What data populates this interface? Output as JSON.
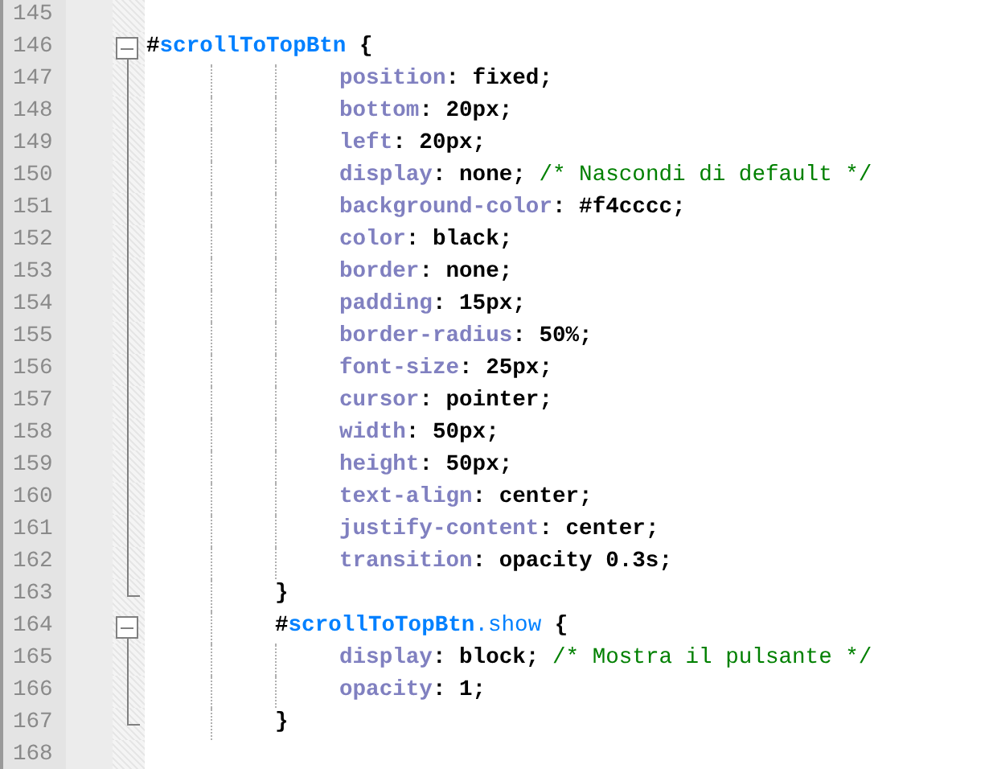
{
  "editor": {
    "lines": [
      {
        "number": "145",
        "kind": "blank"
      },
      {
        "number": "146",
        "kind": "rule",
        "tokens": [
          {
            "kind": "punct",
            "text": "#"
          },
          {
            "kind": "selector",
            "text": "scrollToTopBtn"
          },
          {
            "kind": "punct",
            "text": " {"
          }
        ]
      },
      {
        "number": "147",
        "kind": "declaration",
        "tokens": [
          {
            "kind": "property",
            "text": "position"
          },
          {
            "kind": "value",
            "text": ": fixed;"
          }
        ]
      },
      {
        "number": "148",
        "kind": "declaration",
        "tokens": [
          {
            "kind": "property",
            "text": "bottom"
          },
          {
            "kind": "value",
            "text": ": 20px;"
          }
        ]
      },
      {
        "number": "149",
        "kind": "declaration",
        "tokens": [
          {
            "kind": "property",
            "text": "left"
          },
          {
            "kind": "value",
            "text": ": 20px;"
          }
        ]
      },
      {
        "number": "150",
        "kind": "declaration",
        "tokens": [
          {
            "kind": "property",
            "text": "display"
          },
          {
            "kind": "value",
            "text": ": none; "
          },
          {
            "kind": "comment",
            "text": "/* Nascondi di default */"
          }
        ]
      },
      {
        "number": "151",
        "kind": "declaration",
        "tokens": [
          {
            "kind": "property",
            "text": "background-color"
          },
          {
            "kind": "value",
            "text": ": #f4cccc;"
          }
        ]
      },
      {
        "number": "152",
        "kind": "declaration",
        "tokens": [
          {
            "kind": "property",
            "text": "color"
          },
          {
            "kind": "value",
            "text": ": black;"
          }
        ]
      },
      {
        "number": "153",
        "kind": "declaration",
        "tokens": [
          {
            "kind": "property",
            "text": "border"
          },
          {
            "kind": "value",
            "text": ": none;"
          }
        ]
      },
      {
        "number": "154",
        "kind": "declaration",
        "tokens": [
          {
            "kind": "property",
            "text": "padding"
          },
          {
            "kind": "value",
            "text": ": 15px;"
          }
        ]
      },
      {
        "number": "155",
        "kind": "declaration",
        "tokens": [
          {
            "kind": "property",
            "text": "border-radius"
          },
          {
            "kind": "value",
            "text": ": 50%;"
          }
        ]
      },
      {
        "number": "156",
        "kind": "declaration",
        "tokens": [
          {
            "kind": "property",
            "text": "font-size"
          },
          {
            "kind": "value",
            "text": ": 25px;"
          }
        ]
      },
      {
        "number": "157",
        "kind": "declaration",
        "tokens": [
          {
            "kind": "property",
            "text": "cursor"
          },
          {
            "kind": "value",
            "text": ": pointer;"
          }
        ]
      },
      {
        "number": "158",
        "kind": "declaration",
        "tokens": [
          {
            "kind": "property",
            "text": "width"
          },
          {
            "kind": "value",
            "text": ": 50px;"
          }
        ]
      },
      {
        "number": "159",
        "kind": "declaration",
        "tokens": [
          {
            "kind": "property",
            "text": "height"
          },
          {
            "kind": "value",
            "text": ": 50px;"
          }
        ]
      },
      {
        "number": "160",
        "kind": "declaration",
        "tokens": [
          {
            "kind": "property",
            "text": "text-align"
          },
          {
            "kind": "value",
            "text": ": center;"
          }
        ]
      },
      {
        "number": "161",
        "kind": "declaration",
        "tokens": [
          {
            "kind": "property",
            "text": "justify-content"
          },
          {
            "kind": "value",
            "text": ": center;"
          }
        ]
      },
      {
        "number": "162",
        "kind": "declaration",
        "tokens": [
          {
            "kind": "property",
            "text": "transition"
          },
          {
            "kind": "value",
            "text": ": opacity 0.3s;"
          }
        ]
      },
      {
        "number": "163",
        "kind": "close",
        "tokens": [
          {
            "kind": "punct",
            "text": "}"
          }
        ]
      },
      {
        "number": "164",
        "kind": "nested-rule",
        "tokens": [
          {
            "kind": "punct",
            "text": "#"
          },
          {
            "kind": "selector",
            "text": "scrollToTopBtn"
          },
          {
            "kind": "class",
            "text": ".show"
          },
          {
            "kind": "punct",
            "text": " {"
          }
        ]
      },
      {
        "number": "165",
        "kind": "declaration",
        "tokens": [
          {
            "kind": "property",
            "text": "display"
          },
          {
            "kind": "value",
            "text": ": block; "
          },
          {
            "kind": "comment",
            "text": "/* Mostra il pulsante */"
          }
        ]
      },
      {
        "number": "166",
        "kind": "declaration",
        "tokens": [
          {
            "kind": "property",
            "text": "opacity"
          },
          {
            "kind": "value",
            "text": ": 1;"
          }
        ]
      },
      {
        "number": "167",
        "kind": "close",
        "tokens": [
          {
            "kind": "punct",
            "text": "}"
          }
        ]
      },
      {
        "number": "168",
        "kind": "blank"
      }
    ]
  }
}
